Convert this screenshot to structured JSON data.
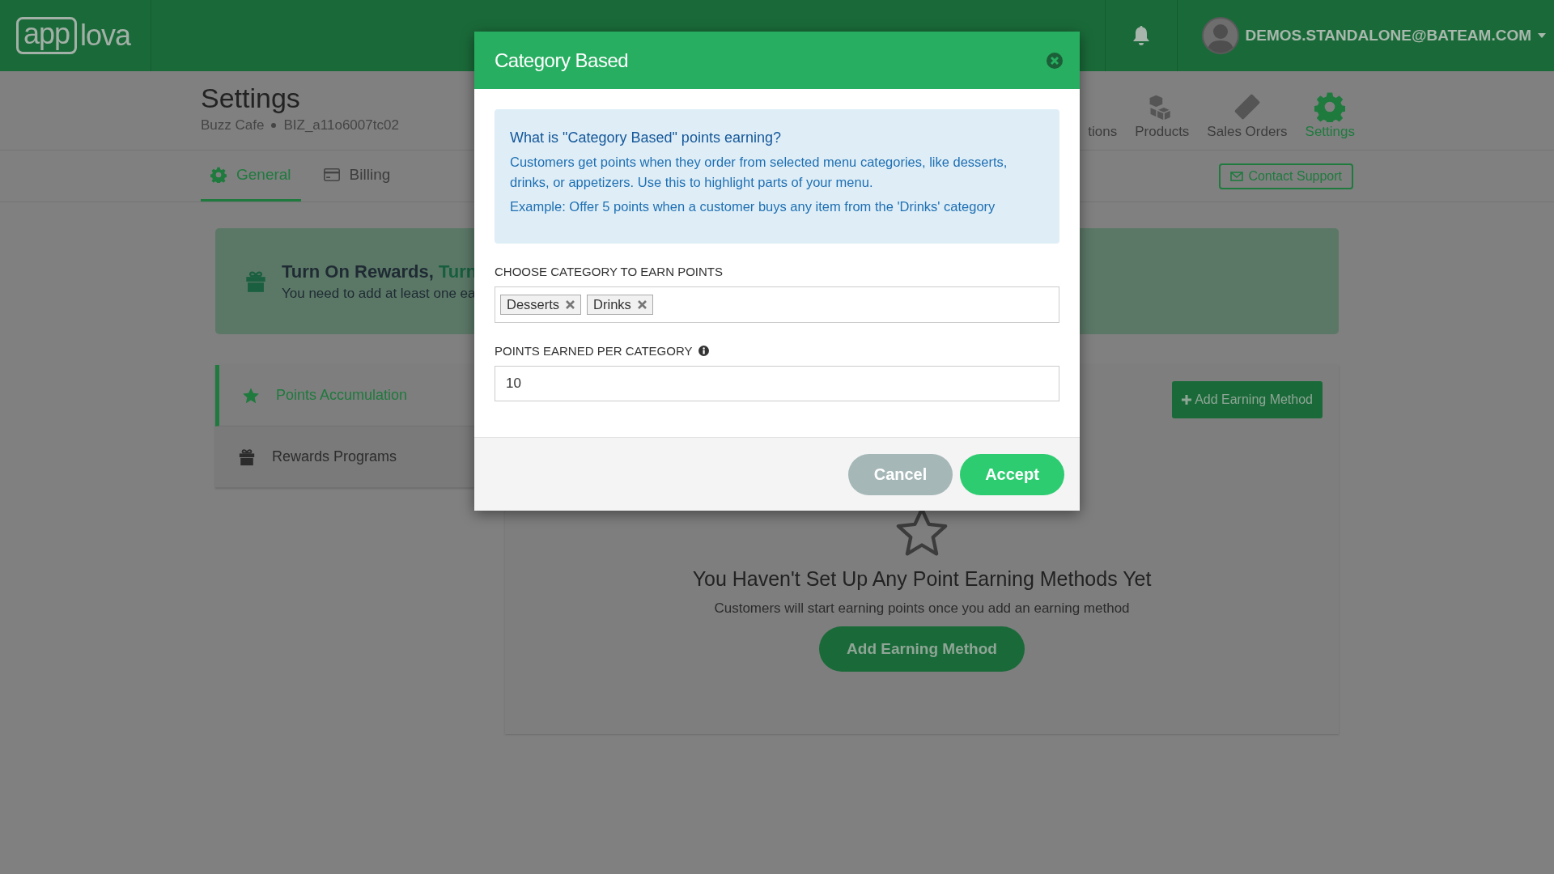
{
  "top_bar": {
    "logo_left": "app",
    "logo_right": "lova",
    "user_email": "DEMOS.STANDALONE@BATEAM.COM"
  },
  "header": {
    "title": "Settings",
    "business_name": "Buzz Cafe",
    "business_id": "BIZ_a11o6007tc02"
  },
  "nav": [
    {
      "label": "tions",
      "selected": false,
      "kind": "hidden"
    },
    {
      "label": "Products",
      "selected": false,
      "kind": "boxes"
    },
    {
      "label": "Sales Orders",
      "selected": false,
      "kind": "ticket"
    },
    {
      "label": "Settings",
      "selected": true,
      "kind": "gear"
    }
  ],
  "tabs": [
    {
      "label": "General",
      "selected": true,
      "kind": "gear"
    },
    {
      "label": "Billing",
      "selected": false,
      "kind": "card"
    }
  ],
  "contact_button": "Contact Support",
  "banner": {
    "title": "Turn On Rewards,",
    "title_highlight": "Turn",
    "text": "You need to add at least one ea"
  },
  "menu": [
    {
      "label": "Points Accumulation",
      "selected": true,
      "kind": "star"
    },
    {
      "label": "Rewards Programs",
      "selected": false,
      "kind": "gift"
    }
  ],
  "earning": {
    "add_button": "Add Earning Method",
    "empty_title": "You Haven't Set Up Any Point Earning Methods Yet",
    "empty_text": "Customers will start earning points once you add an earning method",
    "cta_button": "Add Earning Method"
  },
  "modal": {
    "title": "Category Based",
    "info_title": "What is \"Category Based\" points earning?",
    "info_text": "Customers get points when they order from selected menu categories, like desserts, drinks, or appetizers. Use this to highlight parts of your menu.",
    "info_example": "Example: Offer 5 points when a customer buys any item from the 'Drinks' category",
    "category_label": "CHOOSE CATEGORY TO EARN POINTS",
    "categories": [
      "Desserts",
      "Drinks"
    ],
    "points_label": "POINTS EARNED PER CATEGORY",
    "points_value": "10",
    "buttons": [
      {
        "label": "Cancel",
        "kind": "secondary"
      },
      {
        "label": "Accept",
        "kind": "primary"
      }
    ]
  }
}
